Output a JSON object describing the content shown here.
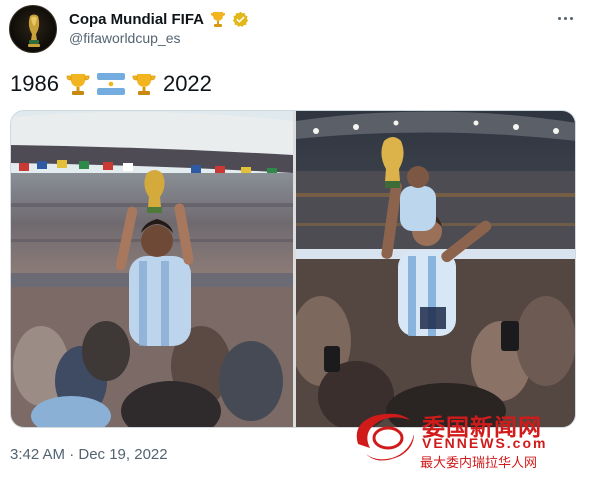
{
  "account": {
    "display_name": "Copa Mundial FIFA",
    "handle": "@fifaworldcup_es",
    "badge_icon": "trophy-icon",
    "verified_icon": "verified-badge-icon"
  },
  "tweet": {
    "year_start": "1986",
    "year_end": "2022",
    "emojis": [
      "trophy-icon",
      "argentina-flag-icon",
      "trophy-icon"
    ]
  },
  "media": {
    "left_photo": "maradona-1986-photo",
    "right_photo": "messi-2022-photo"
  },
  "timestamp": "3:42 AM · Dec 19, 2022",
  "watermark": {
    "title": "委国新闻网",
    "url": "VENNEWS.com",
    "subtitle": "最大委内瑞拉华人网"
  },
  "colors": {
    "text_primary": "#0f1419",
    "text_secondary": "#536471",
    "verified_gold": "#e2b719",
    "watermark_red": "#d11b1b",
    "argentina_blue": "#74acdf"
  }
}
